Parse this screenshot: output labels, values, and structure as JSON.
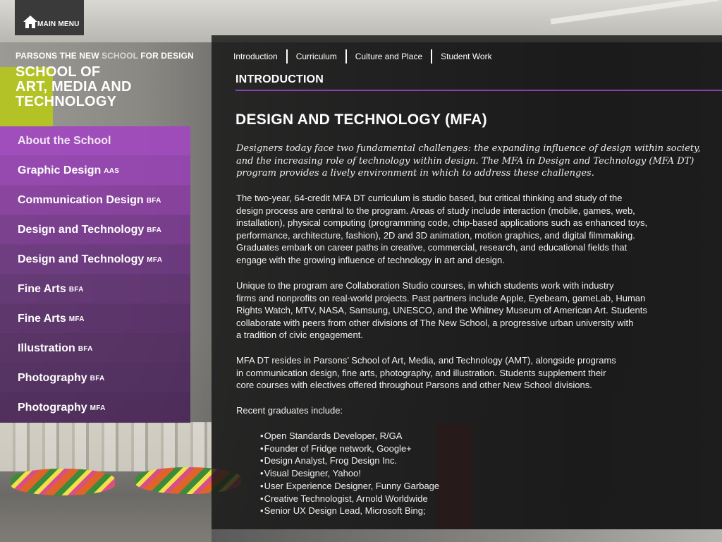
{
  "header": {
    "main_menu_label": "MAIN MENU",
    "parsons_line_a": "PARSONS THE NEW ",
    "parsons_line_b": "SCHOOL",
    "parsons_line_c": " FOR DESIGN",
    "school_title": "SCHOOL OF\nART, MEDIA AND\nTECHNOLOGY"
  },
  "sidebar": {
    "items": [
      {
        "label": "About the School",
        "sub": ""
      },
      {
        "label": "Graphic Design",
        "sub": "AAS"
      },
      {
        "label": "Communication Design",
        "sub": "BFA"
      },
      {
        "label": "Design and Technology",
        "sub": "BFA"
      },
      {
        "label": "Design and Technology",
        "sub": "MFA"
      },
      {
        "label": "Fine Arts",
        "sub": "BFA"
      },
      {
        "label": "Fine Arts",
        "sub": "MFA"
      },
      {
        "label": "Illustration",
        "sub": "BFA"
      },
      {
        "label": "Photography",
        "sub": "BFA"
      },
      {
        "label": "Photography",
        "sub": "MFA"
      }
    ]
  },
  "tabs": [
    "Introduction",
    "Curriculum",
    "Culture and Place",
    "Student Work"
  ],
  "content": {
    "section_label": "INTRODUCTION",
    "title": "DESIGN AND TECHNOLOGY (MFA)",
    "intro_lines": [
      "Designers today face two fundamental challenges: the expanding influence of design within society,",
      "and the increasing role of technology within design. The MFA in Design and Technology (MFA DT)",
      "program provides a lively environment in which to address these challenges."
    ],
    "p1_lines": [
      "The two-year, 64-credit MFA DT curriculum is studio based, but critical thinking and study of the",
      "design process are central to the program. Areas of study include interaction (mobile, games, web,",
      "installation), physical computing (programming code, chip-based applications such as enhanced toys,",
      "performance, architecture, fashion), 2D and 3D animation, motion graphics, and digital filmmaking.",
      "Graduates embark on career paths in creative, commercial, research, and educational fields that",
      "engage with the growing influence of technology in art and design."
    ],
    "p2_lines": [
      "Unique to the program are Collaboration Studio courses, in which students work with industry",
      "firms and nonprofits on real-world projects. Past partners include Apple, Eyebeam, gameLab, Human",
      "Rights Watch, MTV, NASA, Samsung, UNESCO, and the Whitney Museum of American Art. Students",
      "collaborate with peers from other divisions of The New School, a progressive urban university with",
      "a tradition of civic engagement."
    ],
    "p3_lines": [
      "MFA DT resides in Parsons’ School of Art, Media, and Technology (AMT), alongside programs",
      "in communication design, fine arts, photography, and illustration. Students supplement their",
      "core courses with electives offered throughout Parsons and other New School divisions."
    ],
    "p4": "Recent graduates include:",
    "graduates": [
      "Open Standards Developer, R/GA",
      "Founder of Fridge network, Google+",
      "Design Analyst, Frog Design Inc.",
      "Visual Designer, Yahoo!",
      "User Experience Designer, Funny Garbage",
      "Creative Technologist, Arnold Worldwide",
      "Senior UX Design Lead, Microsoft Bing;"
    ]
  },
  "colors": {
    "accent_purple": "#8a3fb0",
    "nav_top": "#a048be",
    "panel_bg": "#161616"
  }
}
